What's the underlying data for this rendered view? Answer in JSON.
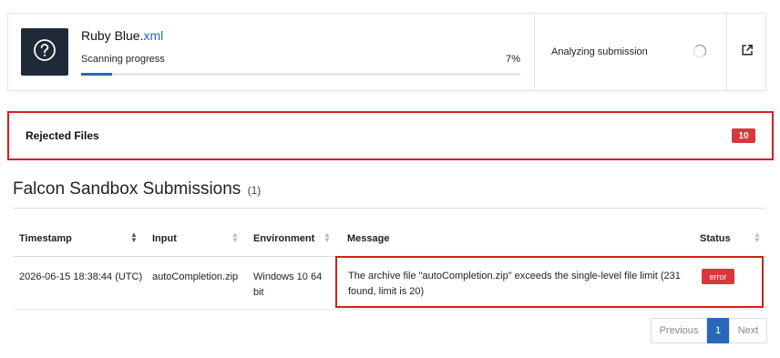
{
  "scan": {
    "file_name": "Ruby Blue.",
    "file_ext": "xml",
    "progress_label": "Scanning progress",
    "progress_percent_text": "7%",
    "progress_value": 0.07,
    "analyzing_label": "Analyzing submission",
    "file_icon": "question-icon",
    "external_icon": "external-link-icon"
  },
  "rejected": {
    "label": "Rejected Files",
    "count": "10"
  },
  "submissions": {
    "title": "Falcon Sandbox Submissions",
    "count": "(1)",
    "columns": {
      "timestamp": "Timestamp",
      "input": "Input",
      "environment": "Environment",
      "message": "Message",
      "status": "Status"
    },
    "rows": [
      {
        "timestamp": "2026-06-15 18:38:44 (UTC)",
        "input": "autoCompletion.zip",
        "environment": "Windows 10 64 bit",
        "message": "The archive file \"autoCompletion.zip\" exceeds the single-level file limit (231 found, limit is 20)",
        "status": "error"
      }
    ]
  },
  "pagination": {
    "previous": "Previous",
    "current": "1",
    "next": "Next"
  },
  "colors": {
    "accent": "#2968b8",
    "error": "#d9393d",
    "highlight_border": "#d81e1e",
    "thumb_bg": "#1f2a38"
  }
}
